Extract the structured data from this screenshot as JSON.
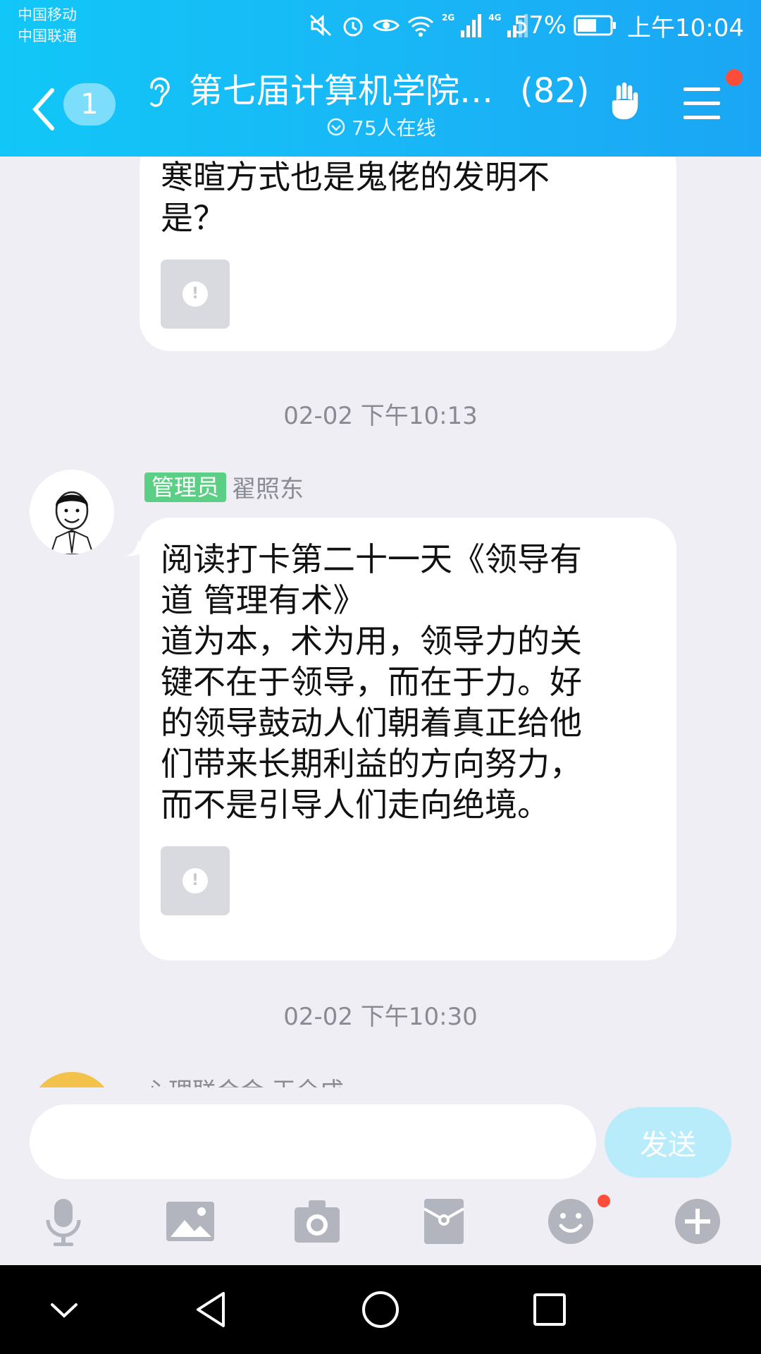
{
  "status_bar": {
    "carrier_1": "中国移动",
    "carrier_2": "中国联通",
    "net_2g": "2G",
    "net_4g": "4G",
    "battery": "57%",
    "time": "上午10:04"
  },
  "header": {
    "unread_count": "1",
    "group_title": "第七届计算机学院…",
    "member_count": "(82)",
    "online": "75人在线",
    "accent_color": "#19b6f6"
  },
  "messages": {
    "msg1_text": "寒暄方式也是鬼佬的发明不\n是？",
    "time_1": "02-02 下午10:13",
    "msg2_role": "管理员",
    "msg2_sender": "翟照东",
    "msg2_text": "阅读打卡第二十一天《领导有\n道 管理有术》\n道为本，术为用，领导力的关\n键不在于领导，而在于力。好\n的领导鼓动人们朝着真正给他\n们带来长期利益的方向努力，\n而不是引导人们走向绝境。",
    "time_2": "02-02 下午10:30",
    "msg3_sender_partial": "心理联合会 王全成"
  },
  "input": {
    "placeholder": "",
    "send_label": "发送"
  },
  "toolbar_icons": [
    "mic-icon",
    "image-icon",
    "camera-icon",
    "red-packet-icon",
    "emoji-icon",
    "plus-icon"
  ],
  "nav_icons": [
    "chevron-down-icon",
    "back-triangle-icon",
    "home-circle-icon",
    "recents-square-icon"
  ]
}
